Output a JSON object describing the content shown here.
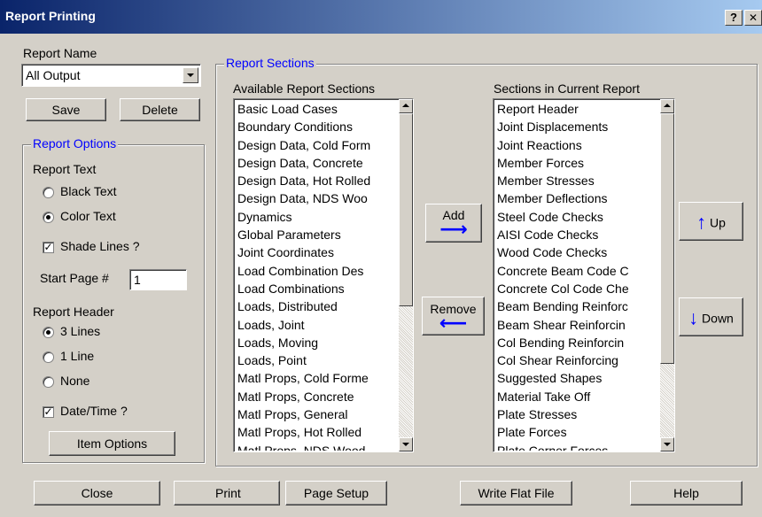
{
  "window": {
    "title": "Report Printing",
    "help_label": "?",
    "close_label": "✕"
  },
  "report_name": {
    "label": "Report Name",
    "value": "All Output"
  },
  "buttons": {
    "save": "Save",
    "delete": "Delete",
    "item_options": "Item Options",
    "add": "Add",
    "remove": "Remove",
    "up": "Up",
    "down": "Down",
    "close": "Close",
    "print": "Print",
    "page_setup": "Page Setup",
    "write_flat_file": "Write Flat File",
    "help": "Help"
  },
  "report_options": {
    "legend": "Report Options",
    "report_text_label": "Report Text",
    "black_text": "Black Text",
    "color_text": "Color Text",
    "shade_lines": "Shade Lines ?",
    "start_page_label": "Start Page #",
    "start_page_value": "1",
    "report_header_label": "Report Header",
    "three_lines": "3 Lines",
    "one_line": "1 Line",
    "none": "None",
    "date_time": "Date/Time ?"
  },
  "report_sections": {
    "legend": "Report Sections",
    "available_label": "Available Report Sections",
    "current_label": "Sections in Current Report",
    "available": [
      "Basic Load Cases",
      "Boundary Conditions",
      "Design Data, Cold Form",
      "Design Data, Concrete",
      "Design Data, Hot Rolled",
      "Design Data, NDS Woo",
      "Dynamics",
      "Global Parameters",
      "Joint Coordinates",
      "Load Combination Des",
      "Load Combinations",
      "Loads, Distributed",
      "Loads, Joint",
      "Loads, Moving",
      "Loads, Point",
      "Matl Props, Cold Forme",
      "Matl Props, Concrete",
      "Matl Props, General",
      "Matl Props, Hot Rolled",
      "Matl Props, NDS Wood"
    ],
    "current": [
      "Report Header",
      "Joint Displacements",
      "Joint Reactions",
      "Member Forces",
      "Member Stresses",
      "Member Deflections",
      "Steel Code Checks",
      "AISI Code Checks",
      "Wood Code Checks",
      "Concrete Beam Code C",
      "Concrete Col Code Che",
      "Beam Bending Reinforc",
      "Beam Shear Reinforcin",
      "Col Bending Reinforcin",
      "Col Shear Reinforcing",
      "Suggested Shapes",
      "Material Take Off",
      "Plate Stresses",
      "Plate Forces",
      "Plate Corner Forces"
    ]
  },
  "colors": {
    "title_bar": "#0a246a",
    "accent": "#0000ff",
    "face": "#d4d0c8"
  }
}
